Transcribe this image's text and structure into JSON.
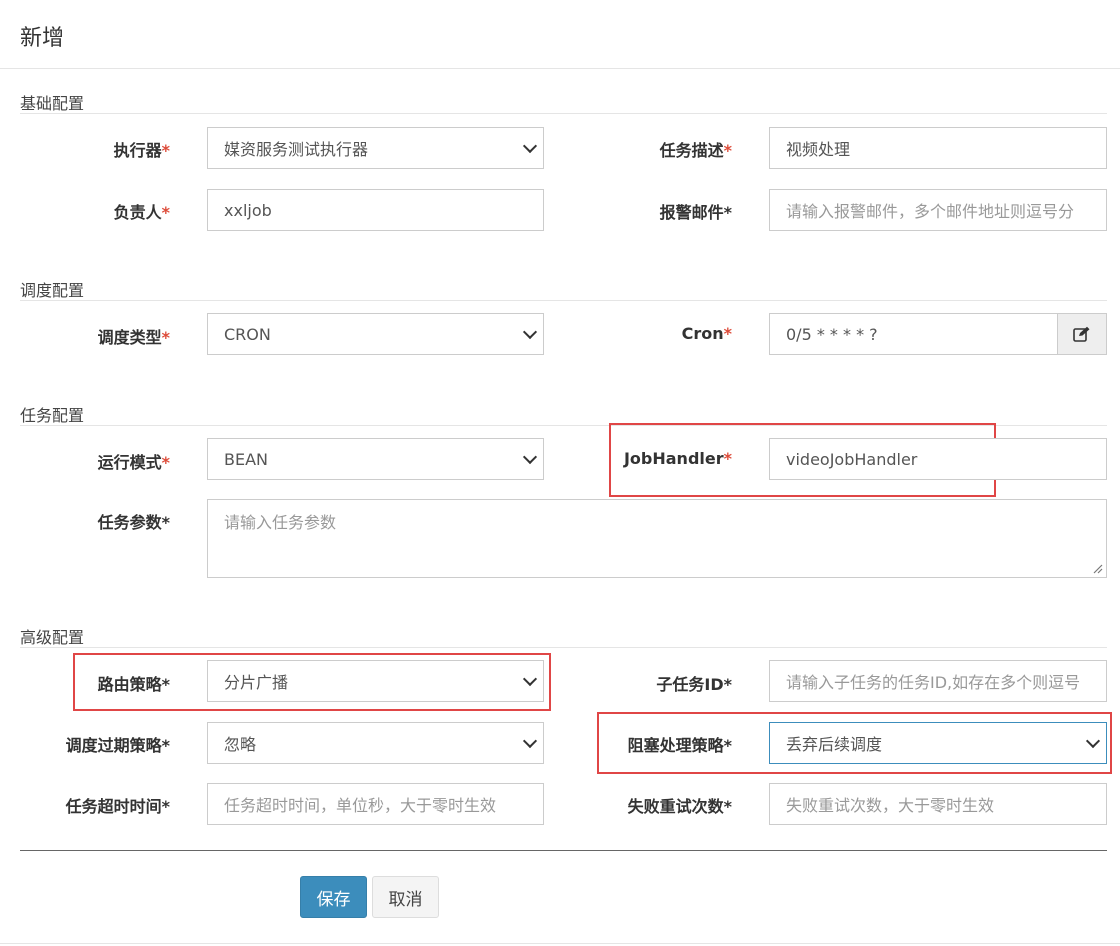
{
  "modal": {
    "title": "新增"
  },
  "sections": {
    "basic": "基础配置",
    "schedule": "调度配置",
    "task": "任务配置",
    "advanced": "高级配置"
  },
  "required_mark": "*",
  "basic": {
    "executor": {
      "label": "执行器",
      "value": "媒资服务测试执行器"
    },
    "job_desc": {
      "label": "任务描述",
      "value": "视频处理"
    },
    "author": {
      "label": "负责人",
      "value": "xxljob"
    },
    "alarm_email": {
      "label": "报警邮件*",
      "placeholder": "请输入报警邮件，多个邮件地址则逗号分"
    }
  },
  "schedule": {
    "schedule_type": {
      "label": "调度类型",
      "value": "CRON"
    },
    "cron": {
      "label": "Cron",
      "value": "0/5 * * * * ?",
      "icon": "edit-icon"
    }
  },
  "task": {
    "glue_type": {
      "label": "运行模式",
      "value": "BEAN"
    },
    "job_handler": {
      "label": "JobHandler",
      "value": "videoJobHandler"
    },
    "job_param": {
      "label": "任务参数*",
      "placeholder": "请输入任务参数"
    }
  },
  "advanced": {
    "route_strategy": {
      "label": "路由策略*",
      "value": "分片广播"
    },
    "child_job_id": {
      "label": "子任务ID*",
      "placeholder": "请输入子任务的任务ID,如存在多个则逗号"
    },
    "misfire_strategy": {
      "label": "调度过期策略*",
      "value": "忽略"
    },
    "block_strategy": {
      "label": "阻塞处理策略*",
      "value": "丢弃后续调度"
    },
    "timeout": {
      "label": "任务超时时间*",
      "placeholder": "任务超时时间，单位秒，大于零时生效"
    },
    "fail_retry": {
      "label": "失败重试次数*",
      "placeholder": "失败重试次数，大于零时生效"
    }
  },
  "buttons": {
    "save": "保存",
    "cancel": "取消"
  },
  "colors": {
    "primary": "#3c8dbc",
    "required": "#dd4b39",
    "highlight": "#e04646"
  }
}
